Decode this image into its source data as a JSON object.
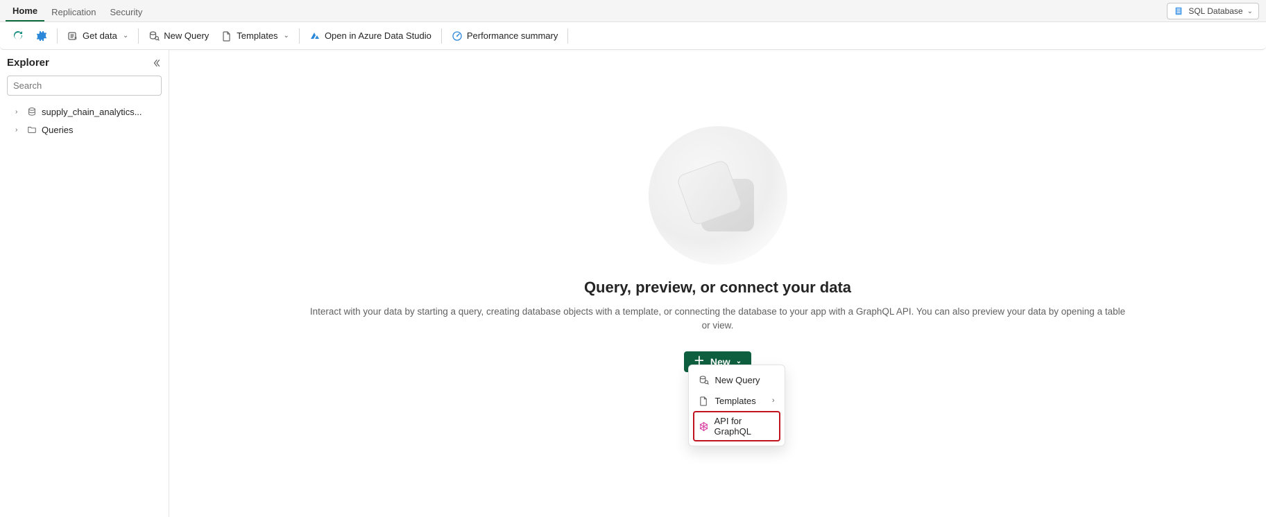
{
  "topNav": {
    "tabs": [
      {
        "label": "Home",
        "active": true
      },
      {
        "label": "Replication",
        "active": false
      },
      {
        "label": "Security",
        "active": false
      }
    ],
    "badge": {
      "label": "SQL Database"
    }
  },
  "toolbar": {
    "getData": "Get data",
    "newQuery": "New Query",
    "templates": "Templates",
    "openAzure": "Open in Azure Data Studio",
    "perfSummary": "Performance summary"
  },
  "sidebar": {
    "title": "Explorer",
    "searchPlaceholder": "Search",
    "items": [
      {
        "label": "supply_chain_analytics...",
        "icon": "database"
      },
      {
        "label": "Queries",
        "icon": "folder"
      }
    ]
  },
  "empty": {
    "heading": "Query, preview, or connect your data",
    "body": "Interact with your data by starting a query, creating database objects with a template, or connecting the database to your app with a GraphQL API. You can also preview your data by opening a table or view.",
    "newLabel": "New"
  },
  "dropdown": {
    "items": [
      {
        "label": "New Query",
        "trailChevron": false,
        "highlighted": false
      },
      {
        "label": "Templates",
        "trailChevron": true,
        "highlighted": false
      },
      {
        "label": "API for GraphQL",
        "trailChevron": false,
        "highlighted": true
      }
    ]
  }
}
